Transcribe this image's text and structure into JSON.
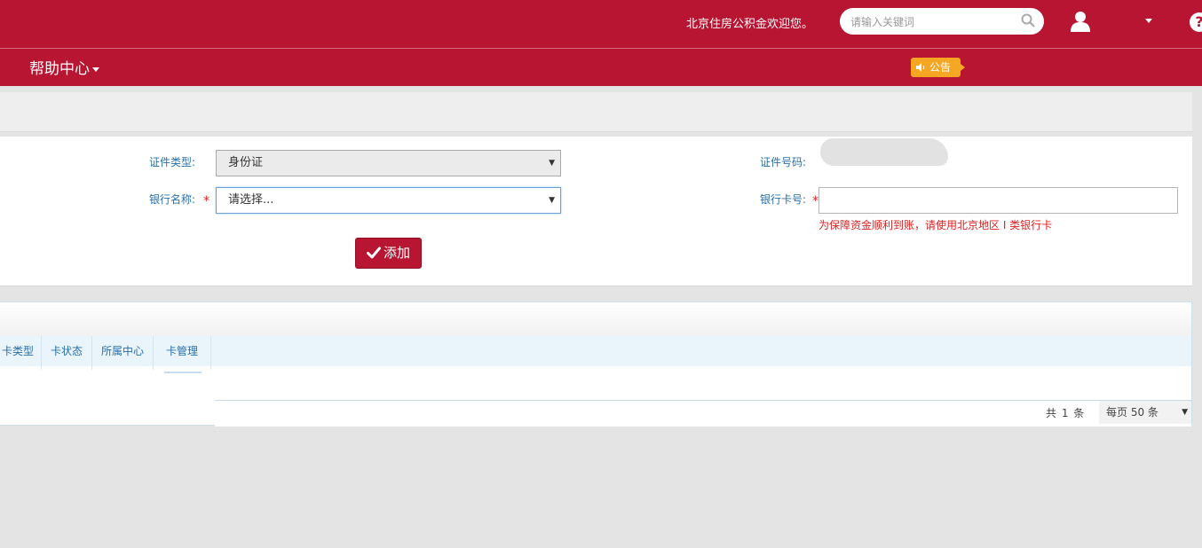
{
  "header": {
    "welcome": "北京住房公积金欢迎您。",
    "search_placeholder": "请输入关键词",
    "help_glyph": "?"
  },
  "nav": {
    "help_center": "帮助中心",
    "notice": "公告"
  },
  "form": {
    "id_type_label": "证件类型:",
    "id_type_value": "身份证",
    "bank_name_label": "银行名称:",
    "bank_name_value": "请选择...",
    "required_mark": "*",
    "id_number_label": "证件号码:",
    "card_number_label": "银行卡号:",
    "card_number_value": "",
    "card_hint": "为保障资金顺利到账，请使用北京地区 I 类银行卡",
    "add_button": "添加",
    "select_arrow": "▼"
  },
  "table": {
    "columns": [
      "卡类型",
      "卡状态",
      "所属中心",
      "卡管理"
    ],
    "rows": [],
    "footer": {
      "total": "共 1 条",
      "per_page": "每页 50 条"
    }
  },
  "colors": {
    "brand": "#b81532",
    "notice": "#f5a623",
    "label": "#2a6fa8",
    "error": "#e02020"
  }
}
